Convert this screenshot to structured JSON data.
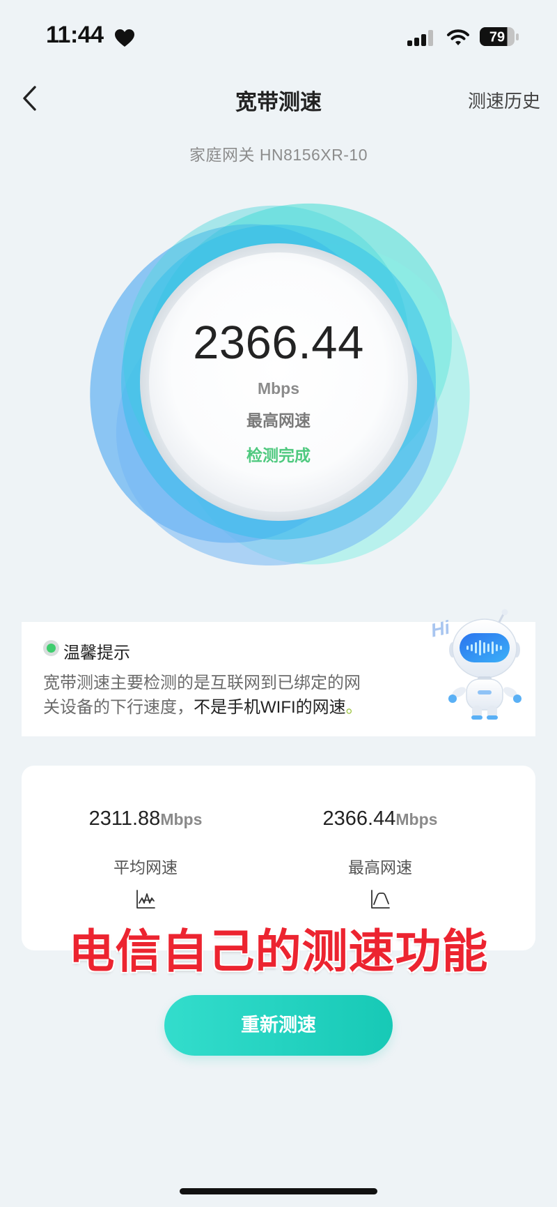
{
  "status_bar": {
    "time": "11:44",
    "battery_level": "79",
    "icons": [
      "heart-icon",
      "signal-icon",
      "wifi-icon",
      "battery-icon"
    ]
  },
  "header": {
    "back_icon": "chevron-left-icon",
    "title": "宽带测速",
    "history_label": "测速历史"
  },
  "device": {
    "label": "家庭网关 HN8156XR-10"
  },
  "speed_gauge": {
    "value": "2366.44",
    "unit": "Mbps",
    "label": "最高网速",
    "status": "检测完成"
  },
  "tip": {
    "title": "温馨提示",
    "lines": [
      "宽带测速主要检测的是互联网到已绑定的网",
      "关设备的下行速度，"
    ],
    "emphasis": "不是手机WIFI的网速",
    "end": "。",
    "mascot_greeting": "Hi",
    "mascot_icon": "robot-mascot-icon"
  },
  "stats": [
    {
      "value": "2311.88",
      "unit": "Mbps",
      "label": "平均网速",
      "icon": "average-speed-chart-icon"
    },
    {
      "value": "2366.44",
      "unit": "Mbps",
      "label": "最高网速",
      "icon": "peak-speed-chart-icon"
    }
  ],
  "overlay_caption": "电信自己的测速功能",
  "retest_button": {
    "label": "重新测速"
  },
  "colors": {
    "background": "#eef3f6",
    "accent_start": "#33ddcc",
    "accent_end": "#17c9b6",
    "success": "#4fc97f",
    "caption_red": "#ec2430"
  }
}
